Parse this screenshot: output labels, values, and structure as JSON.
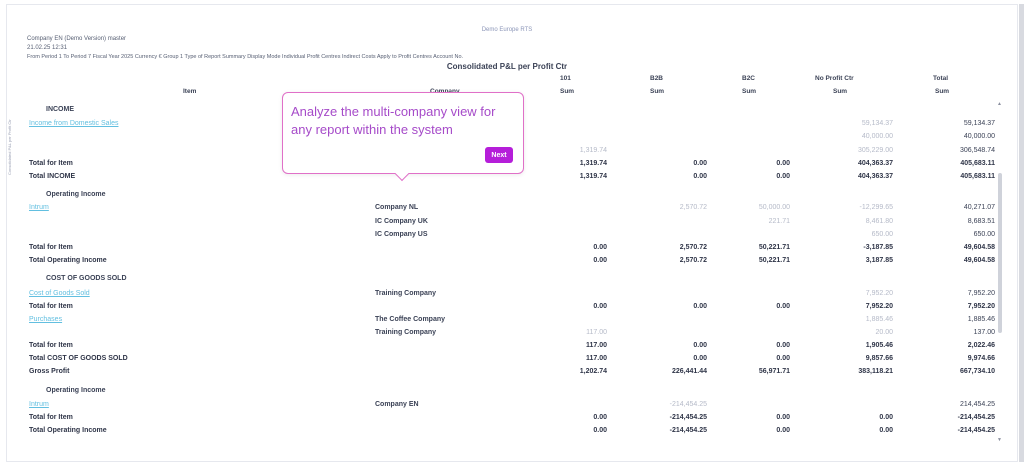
{
  "report": {
    "org_name": "Demo Europe RTS",
    "company_line": "Company EN (Demo Version) master",
    "time_line": "21.02.25 12:31",
    "params_line": "From Period 1 To Period 7 Fiscal Year 2025 Currency € Group 1 Type of Report Summary Display Mode Individual Profit Centres Indirect Costs Apply to Profit Centres Account No.",
    "title": "Consolidated P&L per Profit Ctr",
    "side_label": "Consolidated P&L per Profit Ctr"
  },
  "columns": {
    "item": "Item",
    "company": "Company",
    "c101": "101",
    "b2b": "B2B",
    "b2c": "B2C",
    "npc": "No Profit Ctr",
    "total": "Total",
    "sum": "Sum"
  },
  "rows": [
    {
      "name": "section-income",
      "type": "section",
      "item": "INCOME",
      "company": "",
      "v": [
        "",
        "",
        "",
        "",
        ""
      ]
    },
    {
      "name": "income-domestic-sales",
      "type": "link",
      "item": "Income from Domestic Sales",
      "company": "",
      "v": [
        "",
        "",
        "",
        "59,134.37",
        "59,134.37"
      ],
      "faint": [
        0,
        0,
        0,
        1,
        0
      ]
    },
    {
      "name": "income-row-2",
      "type": "plain",
      "item": "",
      "company": "",
      "v": [
        "",
        "",
        "",
        "40,000.00",
        "40,000.00"
      ],
      "faint": [
        0,
        0,
        0,
        1,
        0
      ]
    },
    {
      "name": "income-row-3",
      "type": "plain",
      "item": "",
      "company": "",
      "v": [
        "1,319.74",
        "",
        "",
        "305,229.00",
        "306,548.74"
      ],
      "faint": [
        1,
        0,
        0,
        1,
        0
      ]
    },
    {
      "name": "income-total-item",
      "type": "bold",
      "item": "Total for Item",
      "company": "",
      "v": [
        "1,319.74",
        "0.00",
        "0.00",
        "404,363.37",
        "405,683.11"
      ]
    },
    {
      "name": "total-income",
      "type": "bold",
      "item": "Total INCOME",
      "company": "",
      "v": [
        "1,319.74",
        "0.00",
        "0.00",
        "404,363.37",
        "405,683.11"
      ]
    },
    {
      "name": "section-operating-income",
      "type": "section",
      "item": "Operating Income",
      "company": "",
      "v": [
        "",
        "",
        "",
        "",
        ""
      ]
    },
    {
      "name": "op-income-nl",
      "type": "link",
      "item": "Intrum",
      "company": "Company NL",
      "v": [
        "",
        "2,570.72",
        "50,000.00",
        "-12,299.65",
        "40,271.07"
      ],
      "faint": [
        0,
        1,
        1,
        1,
        0
      ]
    },
    {
      "name": "op-income-uk",
      "type": "plain",
      "item": "",
      "company": "IC Company UK",
      "v": [
        "",
        "",
        "221.71",
        "8,461.80",
        "8,683.51"
      ],
      "faint": [
        0,
        0,
        1,
        1,
        0
      ]
    },
    {
      "name": "op-income-us",
      "type": "plain",
      "item": "",
      "company": "IC Company US",
      "v": [
        "",
        "",
        "",
        "650.00",
        "650.00"
      ],
      "faint": [
        0,
        0,
        0,
        1,
        0
      ]
    },
    {
      "name": "op-income-total-item",
      "type": "bold",
      "item": "Total for Item",
      "company": "",
      "v": [
        "0.00",
        "2,570.72",
        "50,221.71",
        "-3,187.85",
        "49,604.58"
      ]
    },
    {
      "name": "total-operating-income",
      "type": "bold",
      "item": "Total Operating Income",
      "company": "",
      "v": [
        "0.00",
        "2,570.72",
        "50,221.71",
        "3,187.85",
        "49,604.58"
      ]
    },
    {
      "name": "section-cogs",
      "type": "section",
      "item": "COST OF GOODS SOLD",
      "company": "",
      "v": [
        "",
        "",
        "",
        "",
        ""
      ]
    },
    {
      "name": "cogs-cost-of-goods",
      "type": "link",
      "item": "Cost of Goods Sold",
      "company": "Training Company",
      "v": [
        "",
        "",
        "",
        "7,952.20",
        "7,952.20"
      ],
      "faint": [
        0,
        0,
        0,
        1,
        0
      ]
    },
    {
      "name": "cogs-total-item-1",
      "type": "bold",
      "item": "Total for Item",
      "company": "",
      "v": [
        "0.00",
        "0.00",
        "0.00",
        "7,952.20",
        "7,952.20"
      ]
    },
    {
      "name": "cogs-purchases",
      "type": "link",
      "item": "Purchases",
      "company": "The Coffee Company",
      "v": [
        "",
        "",
        "",
        "1,885.46",
        "1,885.46"
      ],
      "faint": [
        0,
        0,
        0,
        1,
        0
      ]
    },
    {
      "name": "cogs-purchases-training",
      "type": "plain",
      "item": "",
      "company": "Training Company",
      "v": [
        "117.00",
        "",
        "",
        "20.00",
        "137.00"
      ],
      "faint": [
        1,
        0,
        0,
        1,
        0
      ]
    },
    {
      "name": "cogs-total-item-2",
      "type": "bold",
      "item": "Total for Item",
      "company": "",
      "v": [
        "117.00",
        "0.00",
        "0.00",
        "1,905.46",
        "2,022.46"
      ]
    },
    {
      "name": "total-cogs",
      "type": "bold",
      "item": "Total COST OF GOODS SOLD",
      "company": "",
      "v": [
        "117.00",
        "0.00",
        "0.00",
        "9,857.66",
        "9,974.66"
      ]
    },
    {
      "name": "gross-profit",
      "type": "bold",
      "item": "Gross Profit",
      "company": "",
      "v": [
        "1,202.74",
        "226,441.44",
        "56,971.71",
        "383,118.21",
        "667,734.10"
      ]
    },
    {
      "name": "section-operating-income-2",
      "type": "section",
      "item": "Operating Income",
      "company": "",
      "v": [
        "",
        "",
        "",
        "",
        ""
      ]
    },
    {
      "name": "op-income-en",
      "type": "link",
      "item": "Intrum",
      "company": "Company EN",
      "v": [
        "",
        "-214,454.25",
        "",
        "",
        "214,454.25"
      ],
      "faint": [
        0,
        1,
        0,
        0,
        0
      ]
    },
    {
      "name": "op-income-2-total-item",
      "type": "bold",
      "item": "Total for Item",
      "company": "",
      "v": [
        "0.00",
        "-214,454.25",
        "0.00",
        "0.00",
        "-214,454.25"
      ]
    },
    {
      "name": "total-operating-income-2",
      "type": "bold",
      "item": "Total Operating Income",
      "company": "",
      "v": [
        "0.00",
        "-214,454.25",
        "0.00",
        "0.00",
        "-214,454.25"
      ]
    }
  ],
  "tour": {
    "text": "Analyze the multi-company view for any report within the system",
    "next_label": "Next"
  },
  "scroll": {
    "up": "▲",
    "down": "▼"
  },
  "colors": {
    "accent": "#b51ed9",
    "link": "#62bfe0",
    "tour_border": "#e070c8"
  }
}
